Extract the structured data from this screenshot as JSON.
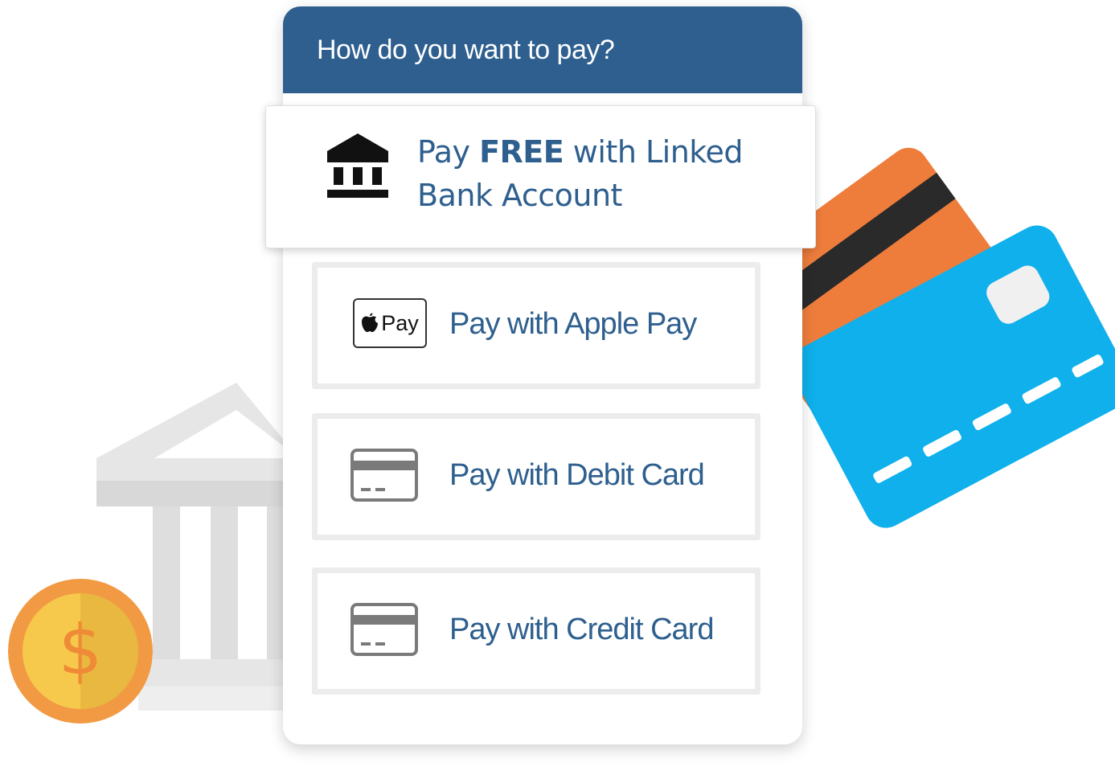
{
  "header": {
    "title": "How do you want to pay?"
  },
  "options": {
    "bank": {
      "prefix": "Pay ",
      "emphasis": "FREE",
      "suffix": " with Linked Bank Account",
      "icon": "bank-icon"
    },
    "apple_pay": {
      "badge_text": "Pay",
      "label": "Pay with Apple Pay",
      "icon": "apple-pay-icon"
    },
    "debit": {
      "label": "Pay with Debit Card",
      "icon": "card-icon"
    },
    "credit": {
      "label": "Pay with Credit Card",
      "icon": "card-icon"
    }
  },
  "coin": {
    "symbol": "$"
  },
  "colors": {
    "header_bg": "#2e5f8e",
    "label_text": "#2e5f8e",
    "card_blue": "#0fb0ec",
    "card_orange": "#ee7d3c",
    "coin_yellow": "#f6c94c",
    "coin_orange": "#f19a43"
  }
}
